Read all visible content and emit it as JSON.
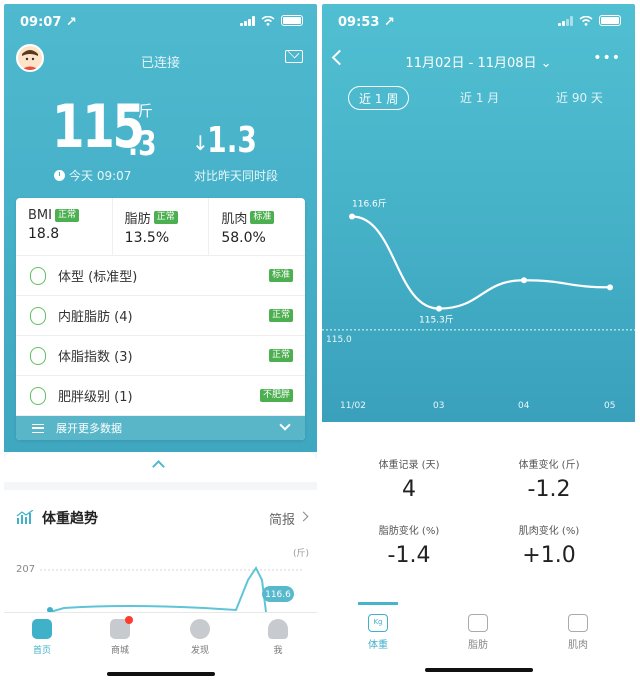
{
  "left": {
    "status": {
      "time": "09:07 ↗"
    },
    "header": {
      "title": "已连接"
    },
    "weight": {
      "int": "115",
      "dec": ".3",
      "unit": "斤",
      "time": "今天 09:07"
    },
    "change": {
      "value": "1.3",
      "arrow": "↓",
      "label": "对比昨天同时段"
    },
    "metrics": [
      {
        "name": "BMI",
        "badge": "正常",
        "value": "18.8"
      },
      {
        "name": "脂肪",
        "badge": "正常",
        "value": "13.5%"
      },
      {
        "name": "肌肉",
        "badge": "标准",
        "value": "58.0%"
      }
    ],
    "rows": [
      {
        "label": "体型 (标准型)",
        "badge": "标准"
      },
      {
        "label": "内脏脂肪 (4)",
        "badge": "正常"
      },
      {
        "label": "体脂指数 (3)",
        "badge": "正常"
      },
      {
        "label": "肥胖级别 (1)",
        "badge": "不肥胖"
      }
    ],
    "expand_label": "展开更多数据",
    "trend": {
      "title": "体重趋势",
      "brief": "简报",
      "unit": "(斤)",
      "ref": "207",
      "bubble": "116.6"
    },
    "tabs": [
      {
        "label": "首页"
      },
      {
        "label": "商城"
      },
      {
        "label": "发现"
      },
      {
        "label": "我"
      }
    ],
    "colors": {
      "accent": "#3fb1c9",
      "normal_badge": "#4caf50",
      "alert_dot": "#ff3b30"
    }
  },
  "right": {
    "status": {
      "time": "09:53 ↗"
    },
    "header": {
      "title": "11月02日 - 11月08日 ⌄"
    },
    "ranges": [
      {
        "label": "近 1 周"
      },
      {
        "label": "近 1 月"
      },
      {
        "label": "近 90 天"
      }
    ],
    "chart_data": {
      "type": "line",
      "x": [
        "11/02",
        "03",
        "04",
        "05"
      ],
      "values": [
        116.6,
        115.3,
        115.7,
        115.6
      ],
      "annotations": [
        {
          "label": "116.6斤"
        },
        {
          "label": "115.3斤"
        }
      ],
      "baseline": 115.0,
      "baseline_label": "115.0"
    },
    "stats": [
      {
        "label": "体重记录 (天)",
        "value": "4"
      },
      {
        "label": "体重变化 (斤)",
        "value": "-1.2"
      },
      {
        "label": "脂肪变化 (%)",
        "value": "-1.4"
      },
      {
        "label": "肌肉变化 (%)",
        "value": "+1.0"
      }
    ],
    "tabs": [
      {
        "label": "体重",
        "icon": "Kg"
      },
      {
        "label": "脂肪",
        "icon": ""
      },
      {
        "label": "肌肉",
        "icon": ""
      }
    ]
  }
}
